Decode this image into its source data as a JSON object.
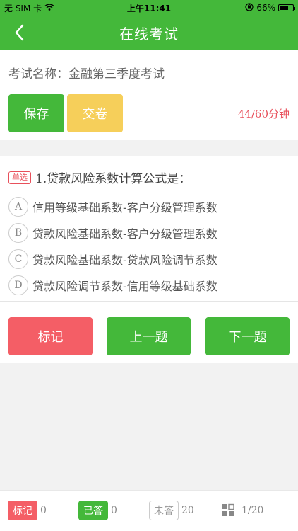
{
  "status_bar": {
    "carrier": "无 SIM 卡",
    "time": "上午11:41",
    "battery": "66%",
    "wifi_icon": "wifi-icon",
    "lock_icon": "orientation-lock-icon",
    "battery_level": 0.66
  },
  "nav": {
    "title": "在线考试",
    "back_icon": "chevron-left-icon"
  },
  "exam": {
    "name_label": "考试名称：",
    "name": "金融第三季度考试",
    "save_label": "保存",
    "submit_label": "交卷",
    "timer": "44/60分钟"
  },
  "question": {
    "type": "单选",
    "text": "1.贷款风险系数计算公式是：",
    "options": [
      {
        "letter": "A",
        "text": "信用等级基础系数-客户分级管理系数"
      },
      {
        "letter": "B",
        "text": "贷款风险基础系数-客户分级管理系数"
      },
      {
        "letter": "C",
        "text": "贷款风险基础系数-贷款风险调节系数"
      },
      {
        "letter": "D",
        "text": "贷款风险调节系数-信用等级基础系数"
      }
    ],
    "mark_label": "标记",
    "prev_label": "上一题",
    "next_label": "下一题"
  },
  "footer": {
    "marked_label": "标记",
    "marked_count": "0",
    "answered_label": "已答",
    "answered_count": "0",
    "unanswered_label": "未答",
    "unanswered_count": "20",
    "grid_icon": "grid-icon",
    "progress": "1/20"
  },
  "colors": {
    "primary_green": "#44b83a",
    "warning_yellow": "#f6cf5a",
    "danger_red": "#f45e66",
    "timer_red": "#e8505b"
  }
}
